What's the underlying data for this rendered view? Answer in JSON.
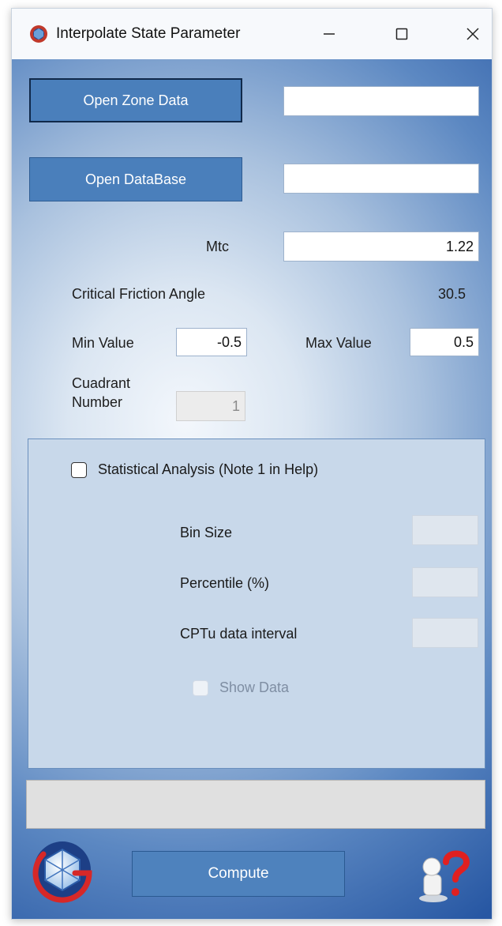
{
  "window": {
    "title": "Interpolate State Parameter",
    "icon": "app-logo-icon"
  },
  "buttons": {
    "open_zone": "Open Zone Data",
    "open_db": "Open DataBase",
    "compute": "Compute"
  },
  "fields": {
    "zone_path": "",
    "db_path": "",
    "mtc_label": "Mtc",
    "mtc_value": "1.22",
    "cfa_label": "Critical Friction Angle",
    "cfa_value": "30.5",
    "min_label": "Min Value",
    "min_value": "-0.5",
    "max_label": "Max Value",
    "max_value": "0.5",
    "quadrant_label": "Cuadrant Number",
    "quadrant_value": "1"
  },
  "stats": {
    "checkbox_label": "Statistical Analysis (Note 1 in Help)",
    "checked": false,
    "bin_size_label": "Bin Size",
    "bin_size_value": "",
    "percentile_label": "Percentile (%)",
    "percentile_value": "",
    "cptu_label": "CPTu data interval",
    "cptu_value": "",
    "show_data_label": "Show Data",
    "show_data_enabled": false
  },
  "status": {
    "text": ""
  },
  "colors": {
    "button_blue": "#4a7fbb",
    "panel_bg": "#c8d8ea",
    "background_dark": "#2757a3"
  },
  "icons": {
    "minimize": "minimize-icon",
    "maximize": "maximize-icon",
    "close": "close-icon",
    "logo": "company-logo-icon",
    "help": "help-icon"
  }
}
